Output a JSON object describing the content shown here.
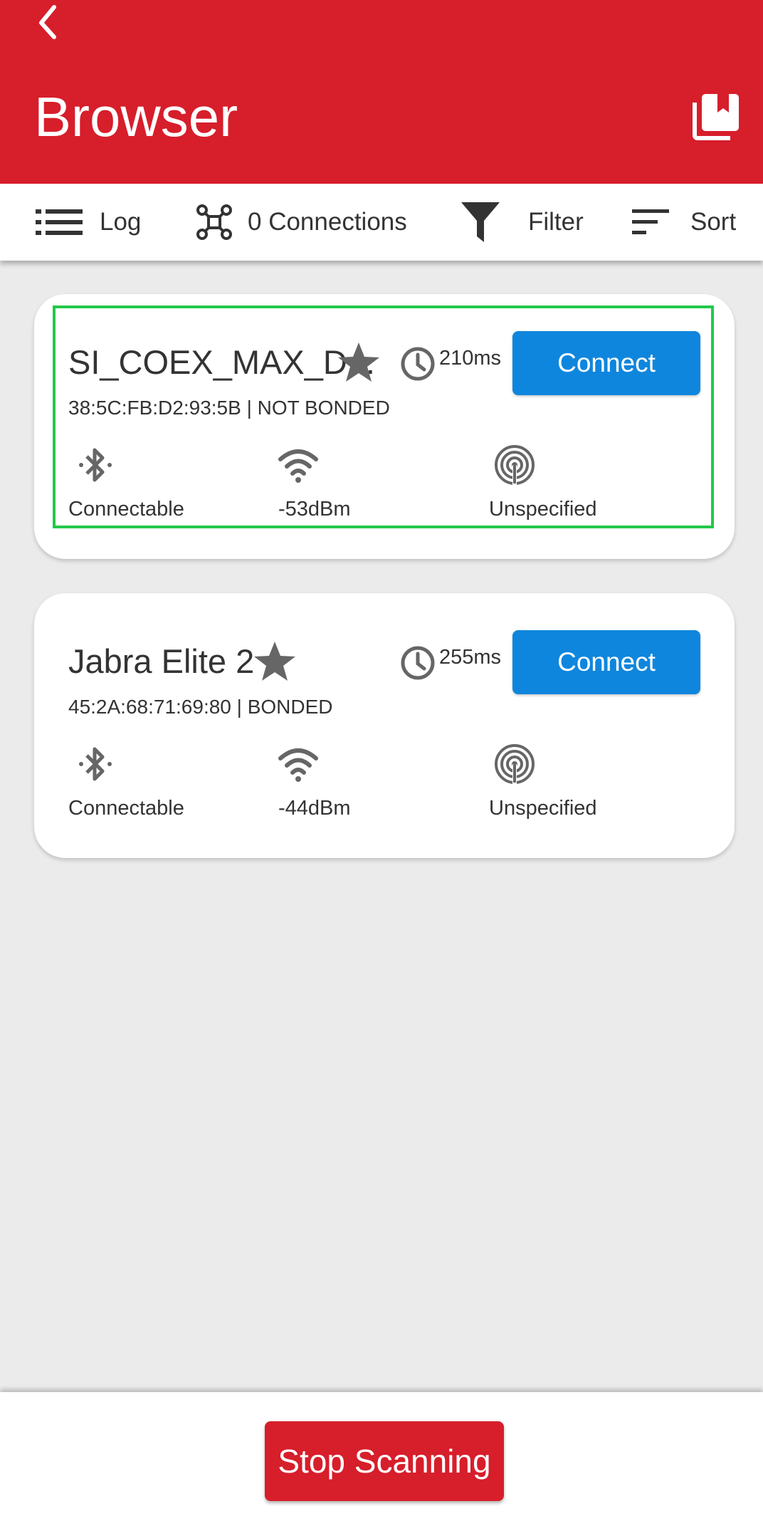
{
  "header": {
    "title": "Browser",
    "back_icon": "chevron-left-icon",
    "bookmark_icon": "bookmarks-icon"
  },
  "toolbar": {
    "log_label": "Log",
    "connections_label": "0 Connections",
    "filter_label": "Filter",
    "sort_label": "Sort"
  },
  "devices": [
    {
      "name": "SI_COEX_MAX_D...",
      "interval": "210ms",
      "address": "38:5C:FB:D2:93:5B | NOT BONDED",
      "connect_label": "Connect",
      "connectable": "Connectable",
      "rssi": "-53dBm",
      "beacon_type": "Unspecified",
      "selected": true
    },
    {
      "name": "Jabra Elite 2",
      "interval": "255ms",
      "address": "45:2A:68:71:69:80 | BONDED",
      "connect_label": "Connect",
      "connectable": "Connectable",
      "rssi": "-44dBm",
      "beacon_type": "Unspecified",
      "selected": false
    }
  ],
  "footer": {
    "stop_label": "Stop Scanning"
  },
  "colors": {
    "primary_red": "#d71e2b",
    "connect_blue": "#0f86dd",
    "selection_green": "#22c94a",
    "background": "#ebebeb"
  }
}
